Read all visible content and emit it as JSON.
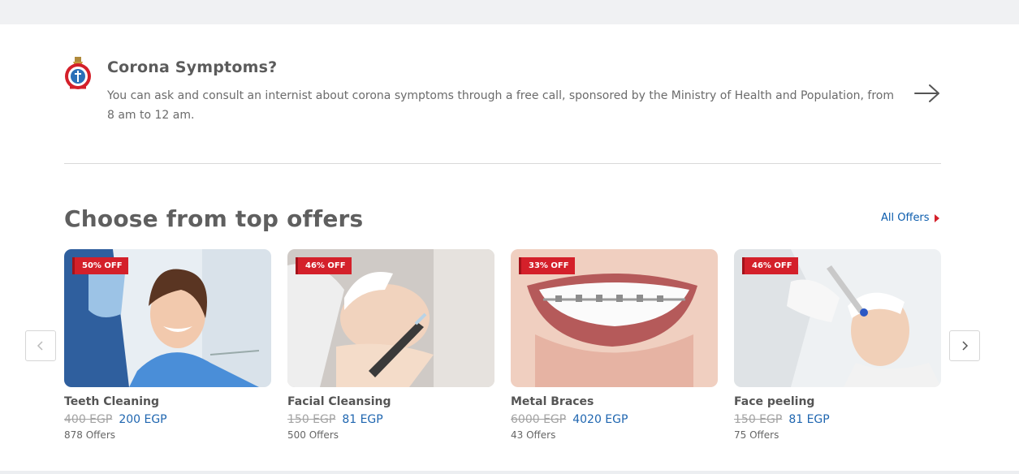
{
  "corona": {
    "title": "Corona Symptoms?",
    "description": "You can ask and consult an internist about corona symptoms through a free call, sponsored by the Ministry of Health and Population, from 8 am to 12 am."
  },
  "offers_section": {
    "title": "Choose from top offers",
    "all_offers_label": "All Offers"
  },
  "offers": [
    {
      "badge": "50% OFF",
      "name": "Teeth Cleaning",
      "old_price": "400 EGP",
      "new_price": "200 EGP",
      "count": "878 Offers"
    },
    {
      "badge": "46% OFF",
      "name": "Facial Cleansing",
      "old_price": "150 EGP",
      "new_price": "81 EGP",
      "count": "500 Offers"
    },
    {
      "badge": "33% OFF",
      "name": "Metal Braces",
      "old_price": "6000 EGP",
      "new_price": "4020 EGP",
      "count": "43 Offers"
    },
    {
      "badge": "46% OFF",
      "name": "Face peeling",
      "old_price": "150 EGP",
      "new_price": "81 EGP",
      "count": "75 Offers"
    }
  ],
  "colors": {
    "accent_red": "#d4202a",
    "link_blue": "#0b5cad",
    "price_blue": "#1f66b0"
  },
  "icons": {
    "corona_logo": "ministry-of-health-logo-icon",
    "corona_arrow": "arrow-right-icon",
    "all_offers": "caret-right-icon",
    "prev": "chevron-left-icon",
    "next": "chevron-right-icon"
  }
}
